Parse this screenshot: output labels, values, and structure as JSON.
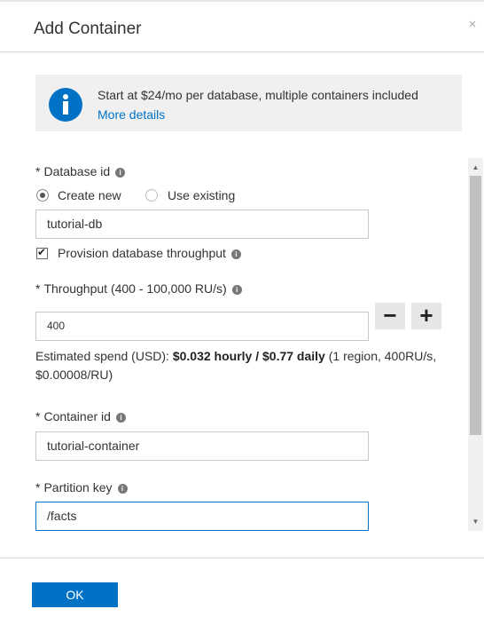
{
  "dialog": {
    "title": "Add Container",
    "close_glyph": "×"
  },
  "info": {
    "icon": "info-icon",
    "text": "Start at $24/mo per database, multiple containers included",
    "link": "More details"
  },
  "database": {
    "label": "Database id",
    "required": "*",
    "create_new": "Create new",
    "use_existing": "Use existing",
    "selected_option": "Create new",
    "value": "tutorial-db",
    "provision_label": "Provision database throughput",
    "provision_checked": true
  },
  "throughput": {
    "label": "Throughput (400 - 100,000 RU/s)",
    "required": "*",
    "value": "400",
    "minus": "−",
    "plus": "+"
  },
  "estimate": {
    "prefix": "Estimated spend (USD): ",
    "bold": "$0.032 hourly / $0.77 daily",
    "suffix": " (1 region, 400RU/s, $0.00008/RU)"
  },
  "container": {
    "label": "Container id",
    "required": "*",
    "value": "tutorial-container"
  },
  "partition": {
    "label": "Partition key",
    "required": "*",
    "value": "/facts"
  },
  "footer": {
    "ok_label": "OK"
  },
  "colors": {
    "accent": "#0072c6",
    "info_bg": "#f0f0f0"
  }
}
